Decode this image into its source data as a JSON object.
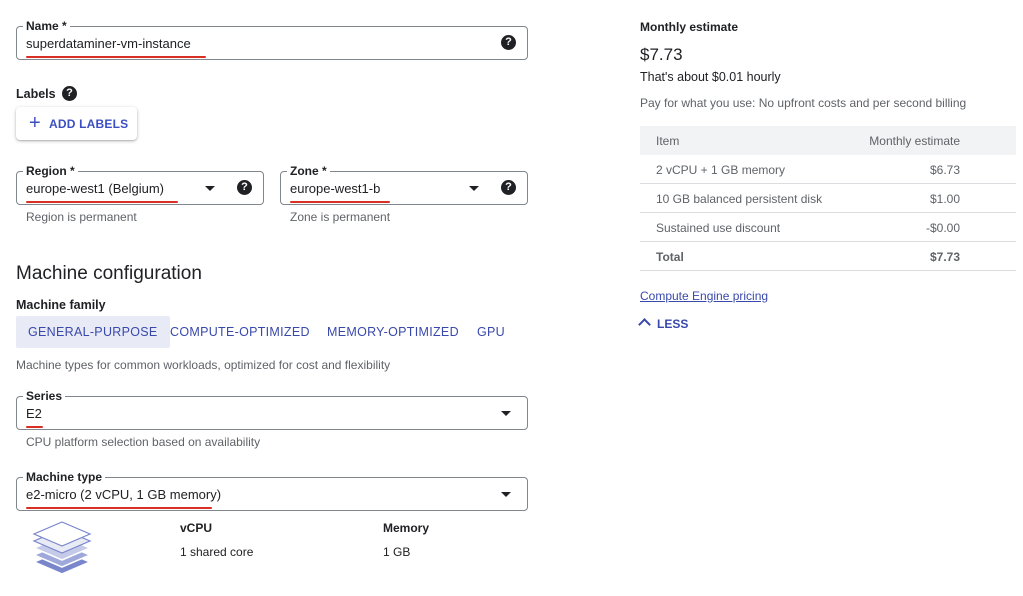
{
  "name_field": {
    "label": "Name *",
    "value": "superdataminer-vm-instance",
    "help_icon": "?"
  },
  "labels": {
    "heading": "Labels",
    "help_icon": "?",
    "add_button": "ADD LABELS",
    "add_icon": "+"
  },
  "region": {
    "label": "Region *",
    "value": "europe-west1 (Belgium)",
    "help_icon": "?",
    "hint": "Region is permanent"
  },
  "zone": {
    "label": "Zone *",
    "value": "europe-west1-b",
    "help_icon": "?",
    "hint": "Zone is permanent"
  },
  "machine_config": {
    "title": "Machine configuration",
    "family_label": "Machine family",
    "tabs": [
      {
        "label": "GENERAL-PURPOSE",
        "active": true
      },
      {
        "label": "COMPUTE-OPTIMIZED",
        "active": false
      },
      {
        "label": "MEMORY-OPTIMIZED",
        "active": false
      },
      {
        "label": "GPU",
        "active": false
      }
    ],
    "family_description": "Machine types for common workloads, optimized for cost and flexibility",
    "series": {
      "label": "Series",
      "value": "E2",
      "hint": "CPU platform selection based on availability"
    },
    "machine_type": {
      "label": "Machine type",
      "value": "e2-micro (2 vCPU, 1 GB memory)"
    },
    "specs": {
      "vcpu_label": "vCPU",
      "vcpu_value": "1 shared core",
      "memory_label": "Memory",
      "memory_value": "1 GB"
    }
  },
  "estimate": {
    "heading": "Monthly estimate",
    "amount": "$7.73",
    "hourly": "That's about $0.01 hourly",
    "note": "Pay for what you use: No upfront costs and per second billing",
    "table_headers": {
      "item": "Item",
      "monthly": "Monthly estimate"
    },
    "rows": [
      {
        "item": "2 vCPU + 1 GB memory",
        "monthly": "$6.73"
      },
      {
        "item": "10 GB balanced persistent disk",
        "monthly": "$1.00"
      },
      {
        "item": "Sustained use discount",
        "monthly": "-$0.00"
      }
    ],
    "total": {
      "item": "Total",
      "monthly": "$7.73"
    },
    "pricing_link": "Compute Engine pricing",
    "less_button": "LESS"
  },
  "colors": {
    "accent": "#3949ab",
    "annotation_underline": "#d93025",
    "tab_active_bg": "#e8eaf6",
    "table_header_bg": "#f1f3f4"
  }
}
